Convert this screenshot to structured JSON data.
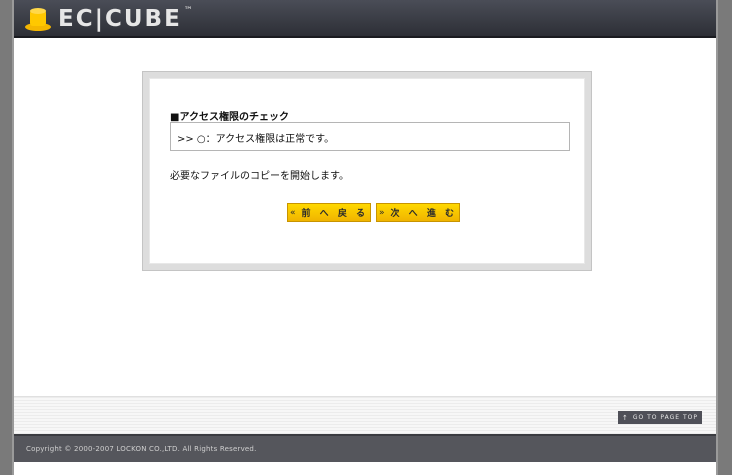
{
  "header": {
    "logo_text": "EC|CUBE",
    "logo_tm": "™"
  },
  "check": {
    "title": "■アクセス権限のチェック",
    "result": ">> ○：アクセス権限は正常です。",
    "message": "必要なファイルのコピーを開始します。"
  },
  "buttons": {
    "prev_arrow": "«",
    "prev_label": "前 へ 戻 る",
    "next_arrow": "»",
    "next_label": "次 へ 進 む"
  },
  "footer": {
    "pagetop_label": "GO TO PAGE TOP",
    "pagetop_icon": "↑",
    "copyright": "Copyright © 2000-2007 LOCKON CO.,LTD. All Rights Reserved."
  },
  "colors": {
    "header_bg": "#2d2f36",
    "button_yellow": "#ffd800",
    "footer_bg": "#55565c"
  }
}
